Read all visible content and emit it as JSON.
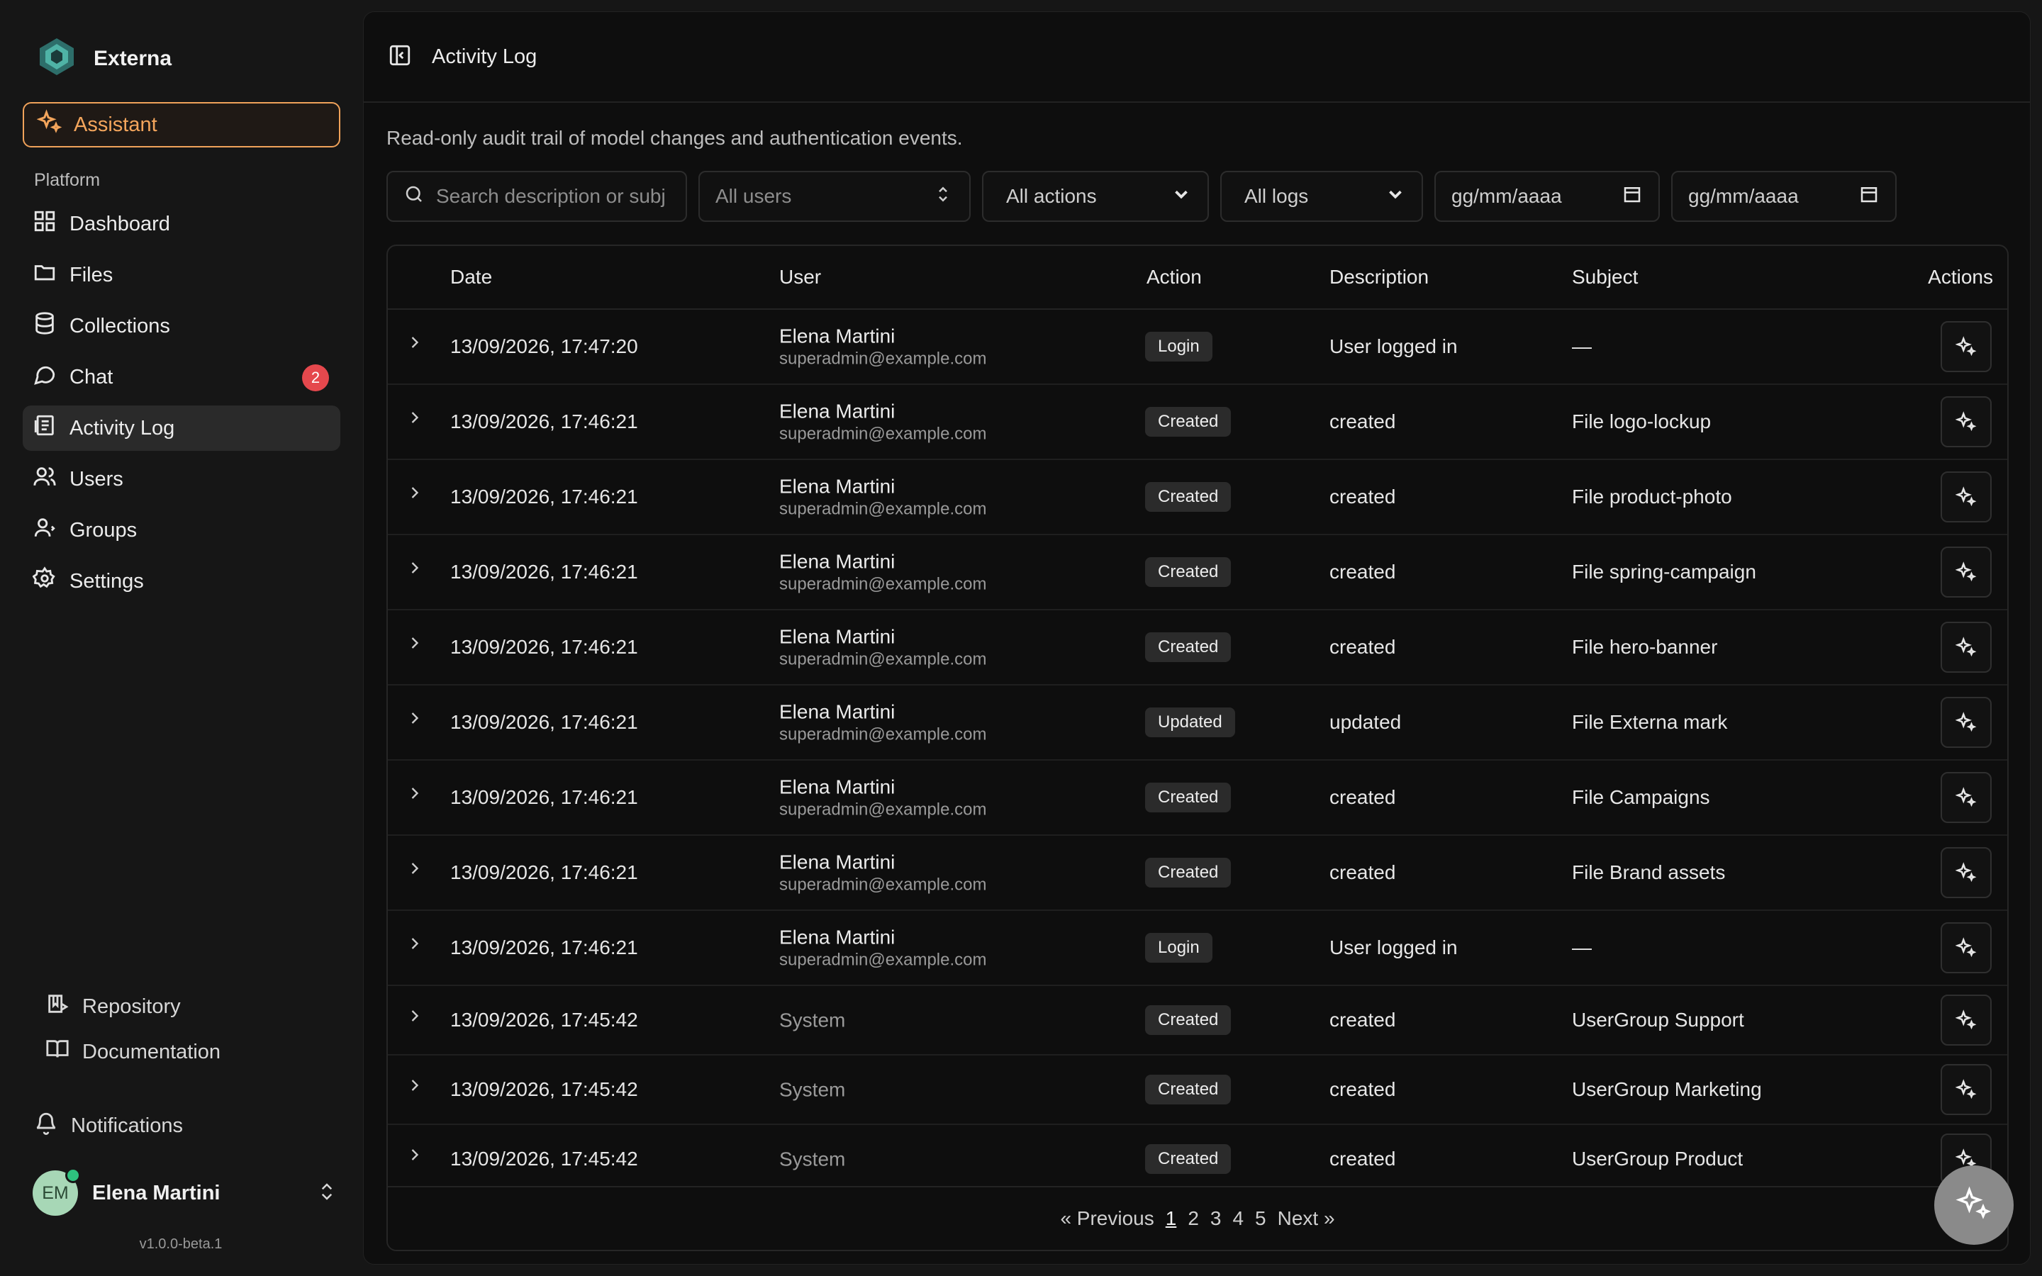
{
  "brand": {
    "name": "Externa"
  },
  "sidebar": {
    "assistant_label": "Assistant",
    "section_label": "Platform",
    "items": [
      {
        "label": "Dashboard",
        "icon": "grid-icon"
      },
      {
        "label": "Files",
        "icon": "folder-icon"
      },
      {
        "label": "Collections",
        "icon": "database-icon"
      },
      {
        "label": "Chat",
        "icon": "chat-icon",
        "badge": "2"
      },
      {
        "label": "Activity Log",
        "icon": "log-icon",
        "active": true
      },
      {
        "label": "Users",
        "icon": "users-icon"
      },
      {
        "label": "Groups",
        "icon": "group-icon"
      },
      {
        "label": "Settings",
        "icon": "gear-icon"
      }
    ],
    "footer": {
      "repository": "Repository",
      "documentation": "Documentation",
      "notifications": "Notifications"
    },
    "user": {
      "initials": "EM",
      "name": "Elena Martini"
    },
    "version": "v1.0.0-beta.1"
  },
  "header": {
    "title": "Activity Log"
  },
  "main": {
    "subtitle": "Read-only audit trail of model changes and authentication events.",
    "filters": {
      "search_placeholder": "Search description or subj",
      "users": "All users",
      "actions": "All actions",
      "logs": "All logs",
      "date_from": "gg/mm/aaaa",
      "date_to": "gg/mm/aaaa"
    },
    "table": {
      "headers": {
        "date": "Date",
        "user": "User",
        "action": "Action",
        "description": "Description",
        "subject": "Subject",
        "actions": "Actions"
      },
      "rows": [
        {
          "date": "13/09/2026, 17:47:20",
          "user": "Elena Martini",
          "email": "superadmin@example.com",
          "action": "Login",
          "description": "User logged in",
          "subject": "—"
        },
        {
          "date": "13/09/2026, 17:46:21",
          "user": "Elena Martini",
          "email": "superadmin@example.com",
          "action": "Created",
          "description": "created",
          "subject": "File logo-lockup"
        },
        {
          "date": "13/09/2026, 17:46:21",
          "user": "Elena Martini",
          "email": "superadmin@example.com",
          "action": "Created",
          "description": "created",
          "subject": "File product-photo"
        },
        {
          "date": "13/09/2026, 17:46:21",
          "user": "Elena Martini",
          "email": "superadmin@example.com",
          "action": "Created",
          "description": "created",
          "subject": "File spring-campaign"
        },
        {
          "date": "13/09/2026, 17:46:21",
          "user": "Elena Martini",
          "email": "superadmin@example.com",
          "action": "Created",
          "description": "created",
          "subject": "File hero-banner"
        },
        {
          "date": "13/09/2026, 17:46:21",
          "user": "Elena Martini",
          "email": "superadmin@example.com",
          "action": "Updated",
          "description": "updated",
          "subject": "File Externa mark"
        },
        {
          "date": "13/09/2026, 17:46:21",
          "user": "Elena Martini",
          "email": "superadmin@example.com",
          "action": "Created",
          "description": "created",
          "subject": "File Campaigns"
        },
        {
          "date": "13/09/2026, 17:46:21",
          "user": "Elena Martini",
          "email": "superadmin@example.com",
          "action": "Created",
          "description": "created",
          "subject": "File Brand assets"
        },
        {
          "date": "13/09/2026, 17:46:21",
          "user": "Elena Martini",
          "email": "superadmin@example.com",
          "action": "Login",
          "description": "User logged in",
          "subject": "—"
        },
        {
          "date": "13/09/2026, 17:45:42",
          "user": "System",
          "email": "",
          "action": "Created",
          "description": "created",
          "subject": "UserGroup Support"
        },
        {
          "date": "13/09/2026, 17:45:42",
          "user": "System",
          "email": "",
          "action": "Created",
          "description": "created",
          "subject": "UserGroup Marketing"
        },
        {
          "date": "13/09/2026, 17:45:42",
          "user": "System",
          "email": "",
          "action": "Created",
          "description": "created",
          "subject": "UserGroup Product"
        }
      ]
    },
    "pagination": {
      "previous": "« Previous",
      "pages": [
        "1",
        "2",
        "3",
        "4",
        "5"
      ],
      "current": "1",
      "next": "Next »"
    }
  }
}
